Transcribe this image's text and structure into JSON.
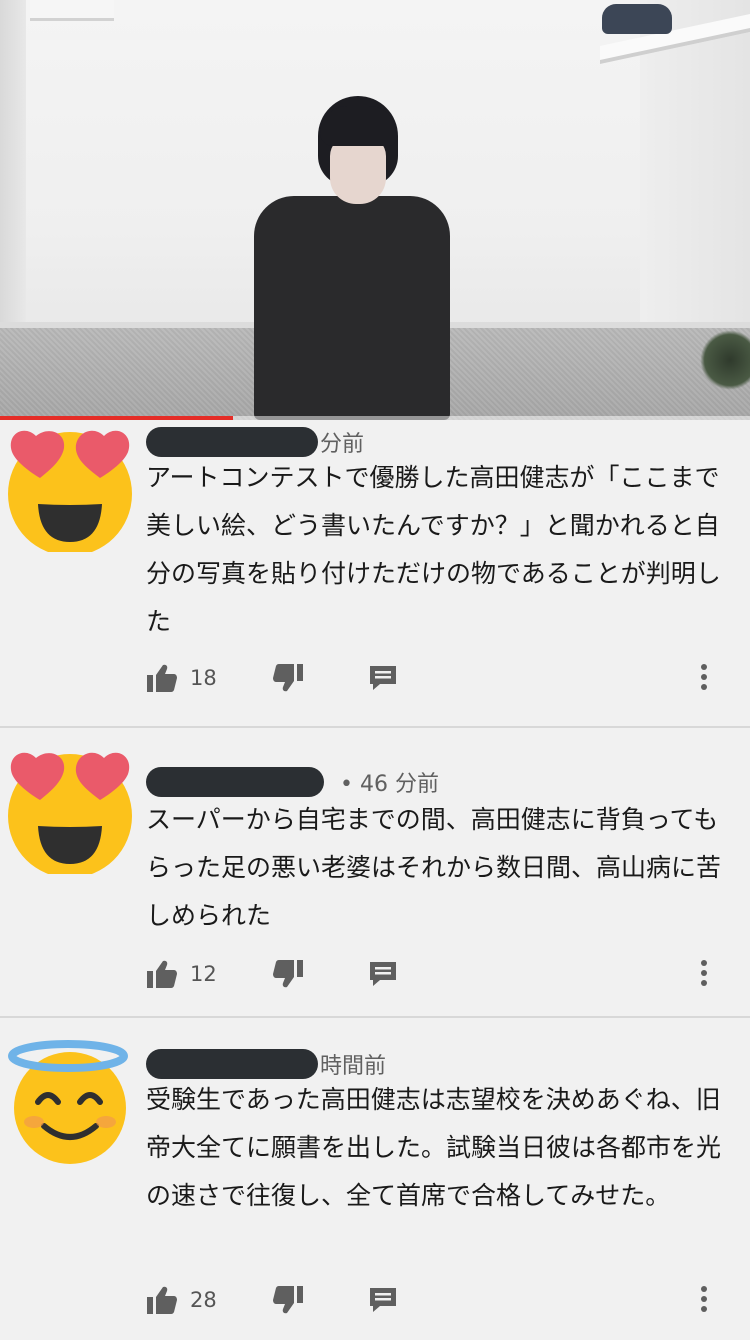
{
  "video": {
    "progress_fraction": 0.31
  },
  "comments": [
    {
      "avatar": "heart-eyes-face-icon",
      "time": "分前",
      "text": "アートコンテストで優勝した高田健志が「ここまで美しい絵、どう書いたんですか？」と聞かれると自分の写真を貼り付けただけの物であることが判明した",
      "likes": "18"
    },
    {
      "avatar": "heart-eyes-face-icon",
      "time": "• 46 分前",
      "text": "スーパーから自宅までの間、高田健志に背負ってもらった足の悪い老婆はそれから数日間、高山病に苦しめられた",
      "likes": "12"
    },
    {
      "avatar": "halo-smiling-face-icon",
      "time": "時間前",
      "text": "受験生であった高田健志は志望校を決めあぐね、旧帝大全てに願書を出した。試験当日彼は各都市を光の速さで往復し、全て首席で合格してみせた。",
      "likes": "28"
    }
  ],
  "colors": {
    "background": "#f1f1f1",
    "progress_red": "#e52d27",
    "icon_gray": "#5f5f5f"
  }
}
